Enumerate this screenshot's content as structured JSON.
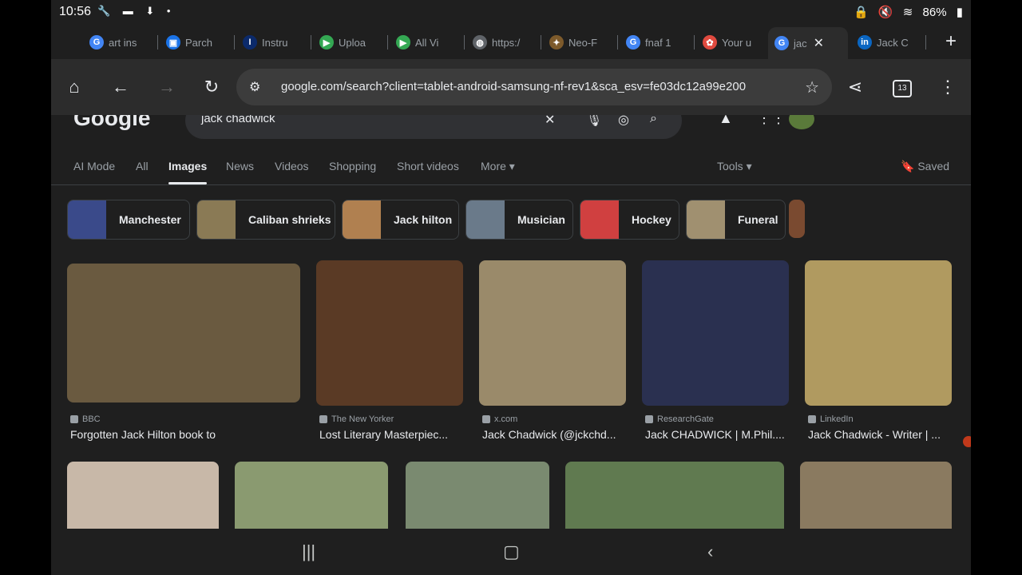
{
  "status": {
    "time": "10:56",
    "battery": "86%"
  },
  "tabs": [
    {
      "label": "art ins",
      "fav_color": "#4285f4",
      "fav": "G"
    },
    {
      "label": "Parch",
      "fav_color": "#1a73e8",
      "fav": "▣"
    },
    {
      "label": "Instru",
      "fav_color": "#0b2a6b",
      "fav": "I"
    },
    {
      "label": "Uploa",
      "fav_color": "#34a853",
      "fav": "▶"
    },
    {
      "label": "All Vi",
      "fav_color": "#34a853",
      "fav": "▶"
    },
    {
      "label": "https:/",
      "fav_color": "#5f6368",
      "fav": "◍"
    },
    {
      "label": "Neo-F",
      "fav_color": "#7d5a2b",
      "fav": "✦"
    },
    {
      "label": "fnaf 1",
      "fav_color": "#4285f4",
      "fav": "G"
    },
    {
      "label": "Your u",
      "fav_color": "#e04a3f",
      "fav": "✿"
    },
    {
      "label": "jac",
      "fav_color": "#4285f4",
      "fav": "G",
      "active": true
    },
    {
      "label": "Jack C",
      "fav_color": "#0a66c2",
      "fav": "in"
    }
  ],
  "toolbar": {
    "url": "google.com/search?client=tablet-android-samsung-nf-rev1&sca_esv=fe03dc12a99e200",
    "tab_count": "13"
  },
  "google": {
    "logo": "Google",
    "query": "jack chadwick"
  },
  "filters": {
    "items": [
      "AI Mode",
      "All",
      "Images",
      "News",
      "Videos",
      "Shopping",
      "Short videos",
      "More ▾"
    ],
    "selected": "Images",
    "tools": "Tools ▾",
    "saved": "Saved"
  },
  "chips": [
    {
      "label": "Manchester",
      "color": "#3a4a8a"
    },
    {
      "label": "Caliban shrieks",
      "color": "#8a7a55"
    },
    {
      "label": "Jack hilton",
      "color": "#b08050"
    },
    {
      "label": "Musician",
      "color": "#6a7a8a"
    },
    {
      "label": "Hockey",
      "color": "#d04040"
    },
    {
      "label": "Funeral",
      "color": "#a09070"
    }
  ],
  "results": [
    {
      "source": "BBC",
      "caption": "Forgotten Jack Hilton book to be ...",
      "color": "#6a5a40"
    },
    {
      "source": "The New Yorker",
      "caption": "Lost Literary Masterpiec...",
      "color": "#5a3a25"
    },
    {
      "source": "x.com",
      "caption": "Jack Chadwick (@jckchd...",
      "color": "#9a8a6a"
    },
    {
      "source": "ResearchGate",
      "caption": "Jack CHADWICK | M.Phil....",
      "color": "#2a3050"
    },
    {
      "source": "LinkedIn",
      "caption": "Jack Chadwick - Writer | ...",
      "color": "#b09a60"
    }
  ],
  "row2_colors": [
    "#c8b8a8",
    "#8a9a70",
    "#7a8a70",
    "#607a50",
    "#8a7a60"
  ]
}
